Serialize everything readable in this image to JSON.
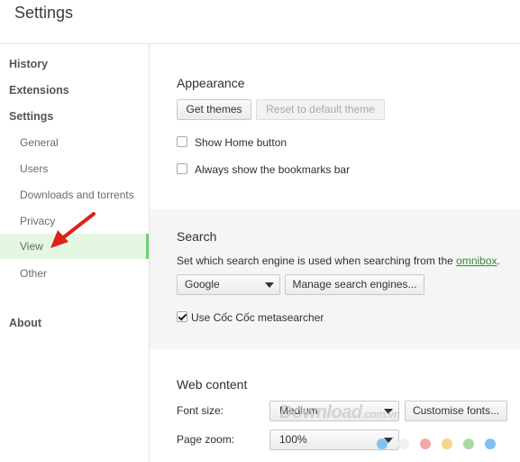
{
  "app": {
    "title": "Settings"
  },
  "sidebar": {
    "items": [
      {
        "label": "History"
      },
      {
        "label": "Extensions"
      },
      {
        "label": "Settings"
      },
      {
        "label": "General"
      },
      {
        "label": "Users"
      },
      {
        "label": "Downloads and torrents"
      },
      {
        "label": "Privacy"
      },
      {
        "label": "View",
        "selected": true
      },
      {
        "label": "Other"
      },
      {
        "label": "About"
      }
    ]
  },
  "appearance": {
    "title": "Appearance",
    "get_themes": "Get themes",
    "reset_theme": "Reset to default theme",
    "show_home": {
      "label": "Show Home button",
      "checked": false
    },
    "show_bookmarks": {
      "label": "Always show the bookmarks bar",
      "checked": false
    }
  },
  "search": {
    "title": "Search",
    "description": "Set which search engine is used when searching from the ",
    "omnibox_link": "omnibox",
    "description_end": ".",
    "engine_value": "Google",
    "manage_button": "Manage search engines...",
    "metasearcher": {
      "label": "Use Cốc Cốc metasearcher",
      "checked": true
    }
  },
  "web_content": {
    "title": "Web content",
    "font_size_label": "Font size:",
    "font_size_value": "Medium",
    "customise_fonts": "Customise fonts...",
    "page_zoom_label": "Page zoom:",
    "page_zoom_value": "100%"
  },
  "watermark": {
    "text": "Download",
    "domain": ".com.vn"
  },
  "colors": {
    "selected_bg": "#e3f7e3",
    "selected_border": "#74cf74",
    "link": "#2e8b2e",
    "arrow": "#e0201b",
    "dots": [
      "#7ec3ef",
      "#f0f0f0",
      "#f3a7a7",
      "#f6d48a",
      "#a9dba2",
      "#7ec3ef",
      "#f3a7a7"
    ]
  }
}
